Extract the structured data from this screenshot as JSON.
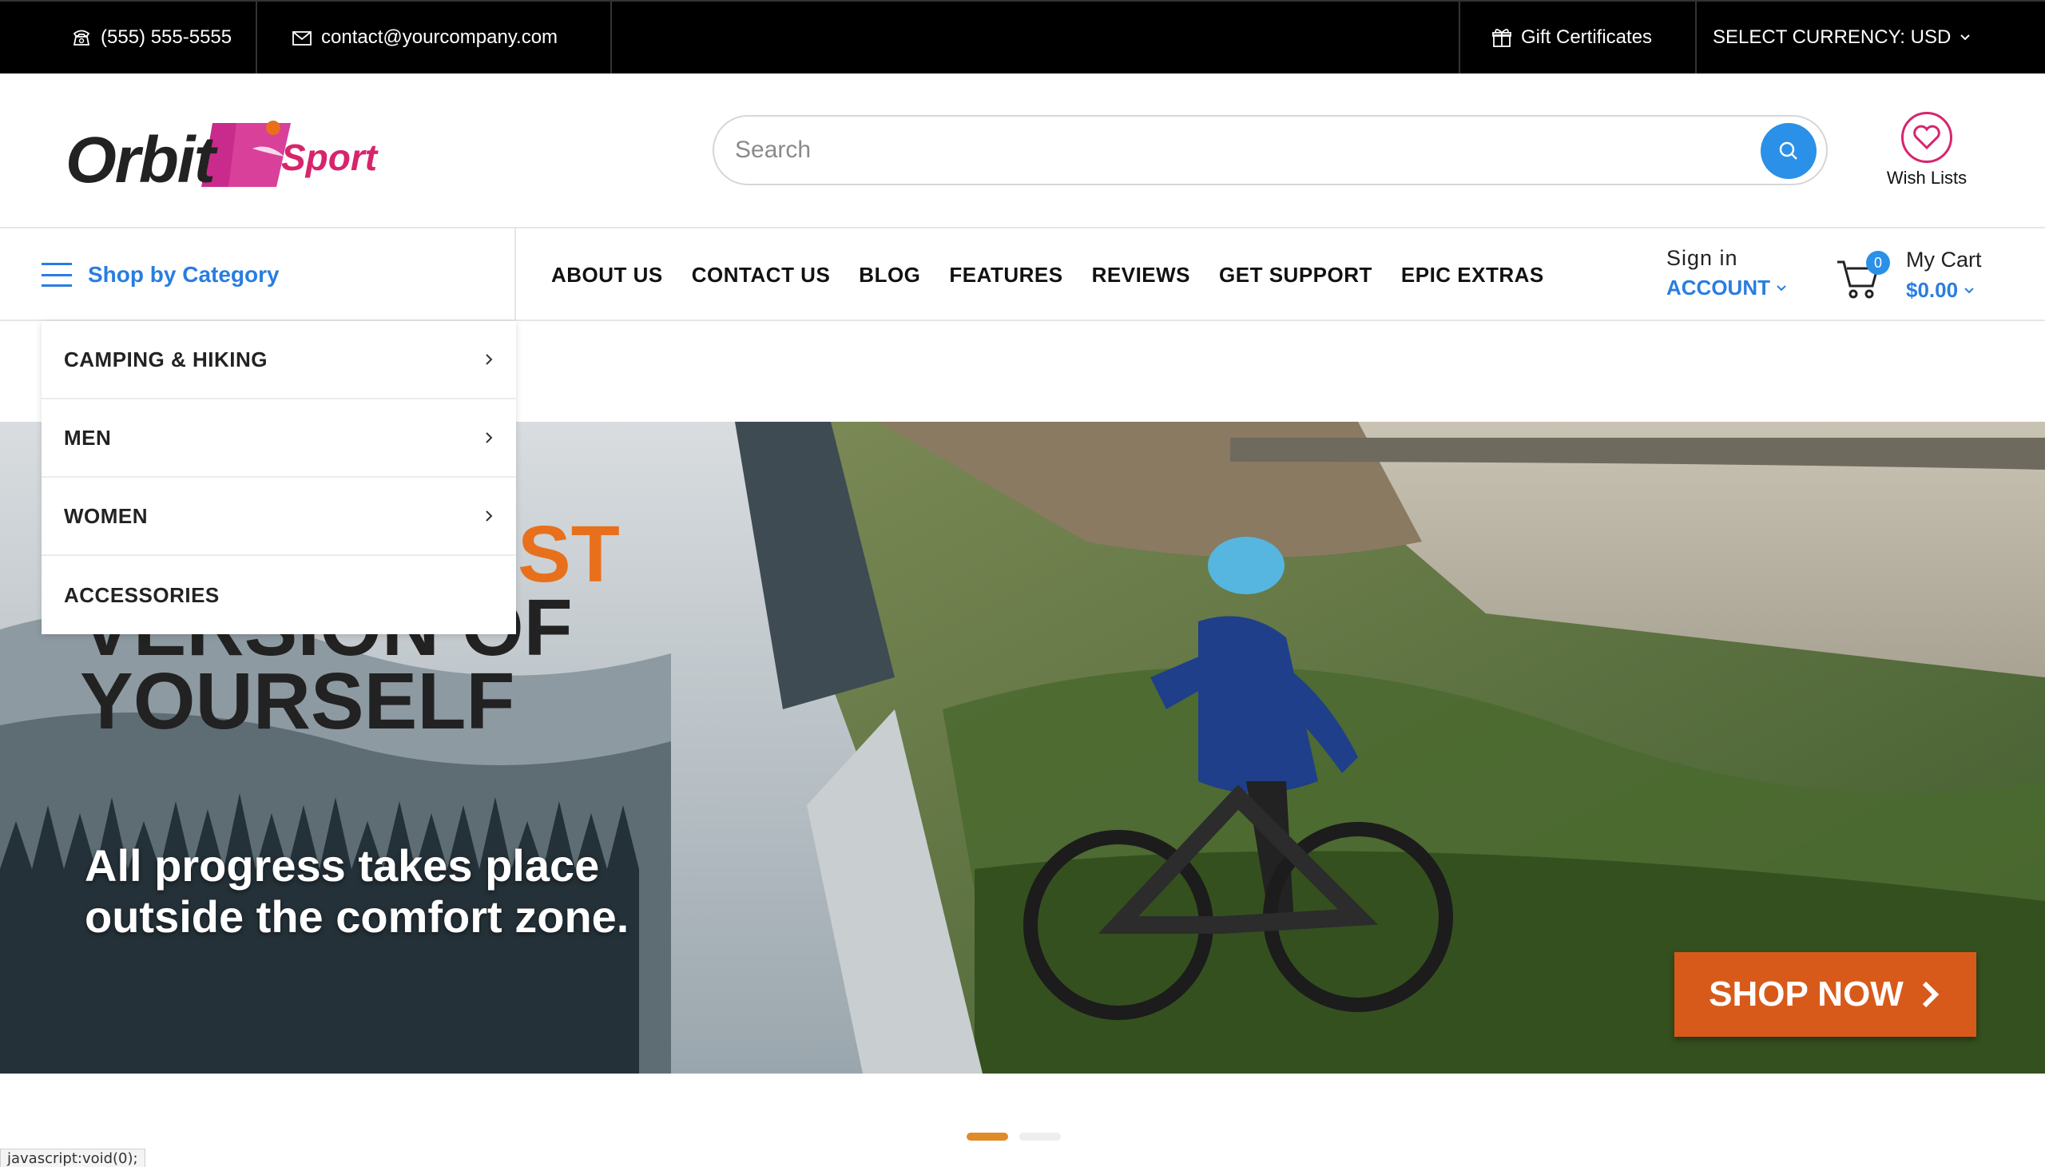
{
  "topbar": {
    "phone": "(555) 555-5555",
    "email": "contact@yourcompany.com",
    "gift": "Gift Certificates",
    "currency": "SELECT CURRENCY: USD"
  },
  "header": {
    "logo_main": "Orbit",
    "logo_sub": "Sport",
    "search_placeholder": "Search",
    "wishlist_label": "Wish Lists"
  },
  "nav": {
    "shop_by_category": "Shop by Category",
    "items": [
      "ABOUT US",
      "CONTACT US",
      "BLOG",
      "FEATURES",
      "REVIEWS",
      "GET SUPPORT",
      "EPIC EXTRAS"
    ],
    "sign_in": "Sign in",
    "account": "ACCOUNT",
    "cart_label": "My Cart",
    "cart_count": "0",
    "cart_total": "$0.00"
  },
  "categories": [
    {
      "label": "CAMPING & HIKING",
      "has_sub": true
    },
    {
      "label": "MEN",
      "has_sub": true
    },
    {
      "label": "WOMEN",
      "has_sub": true
    },
    {
      "label": "ACCESSORIES",
      "has_sub": false
    }
  ],
  "hero": {
    "headline_partial": "ST",
    "headline_line2": "VERSION OF",
    "headline_line3": "YOURSELF",
    "sub_line1": "All progress takes place",
    "sub_line2": "outside the comfort zone.",
    "cta": "SHOP NOW"
  },
  "slider": {
    "active_index": 0,
    "count": 2
  },
  "statusbar": {
    "text": "javascript:void(0);"
  },
  "colors": {
    "accent_blue": "#2a7de0",
    "brand_pink": "#d6256d",
    "cta_orange": "#d85a1a",
    "topbar_bg": "#000000"
  }
}
